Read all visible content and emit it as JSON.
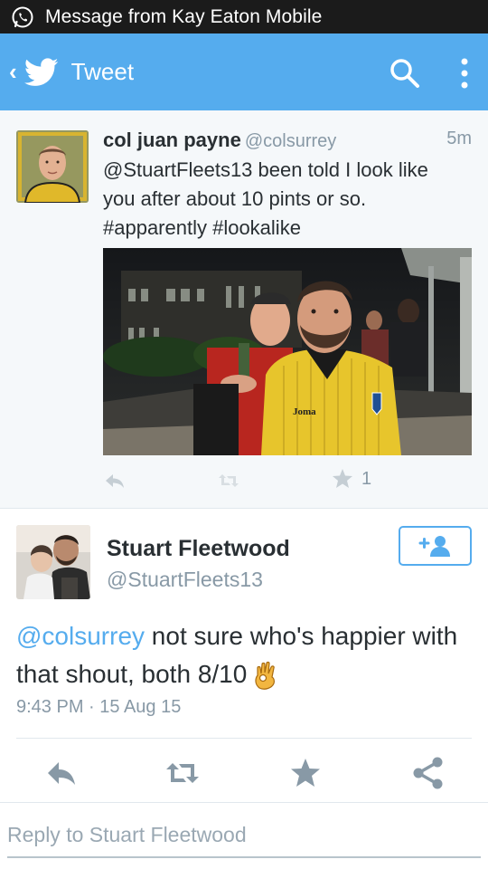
{
  "status_bar": {
    "notification_text": "Message from Kay Eaton Mobile",
    "notification_icon": "whatsapp-icon"
  },
  "action_bar": {
    "title": "Tweet",
    "color": "#55acee",
    "icons": [
      "back-chevron-icon",
      "twitter-bird-icon",
      "search-icon",
      "overflow-menu-icon"
    ]
  },
  "parent_tweet": {
    "name": "col juan payne",
    "handle": "@colsurrey",
    "time": "5m",
    "text": "@StuartFleets13 been told I look like you after about 10 pints or so. #apparently #lookalike",
    "photo_label": "Joma",
    "favorite_count": "1",
    "actions": [
      "reply-icon",
      "retweet-icon",
      "favorite-icon"
    ]
  },
  "main_tweet": {
    "name": "Stuart Fleetwood",
    "handle": "@StuartFleets13",
    "mention": "@colsurrey",
    "text": " not sure who's happier with that shout, both 8/10",
    "emoji": "ok-hand-emoji",
    "meta": "9:43 PM · 15 Aug 15",
    "actions": [
      "reply-icon",
      "retweet-icon",
      "favorite-icon",
      "share-icon"
    ],
    "follow_icon": "add-user-icon"
  },
  "reply": {
    "placeholder": "Reply to Stuart Fleetwood",
    "value": ""
  }
}
